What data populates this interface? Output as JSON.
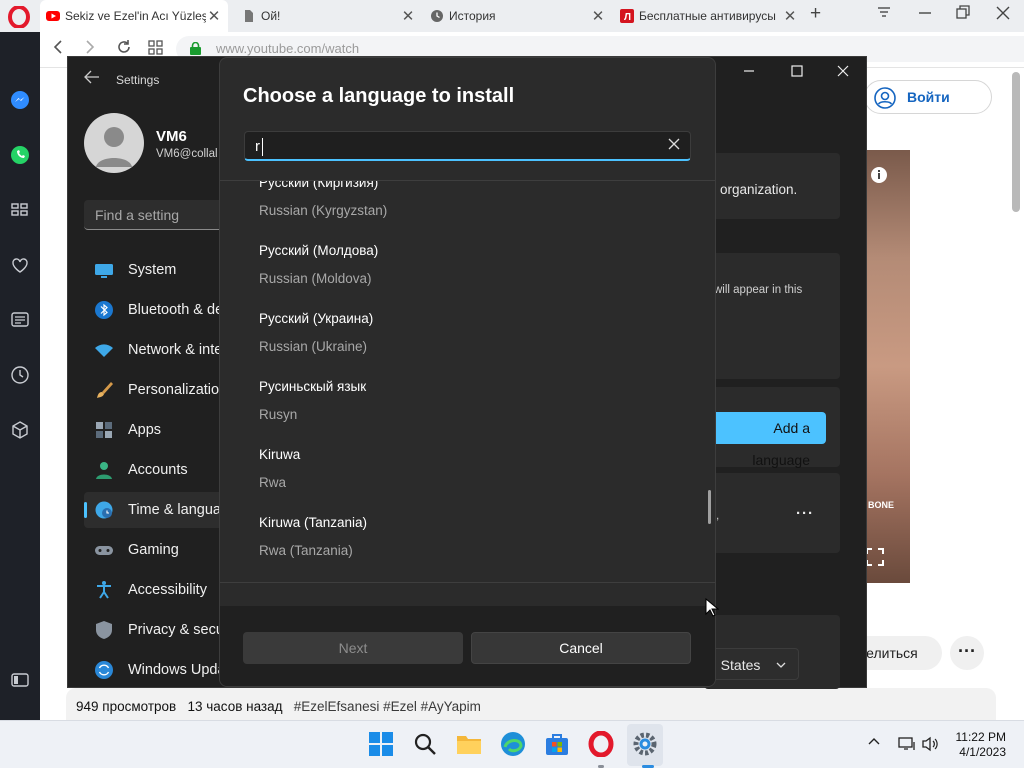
{
  "browser": {
    "tabs": [
      {
        "title": "Sekiz ve Ezel'in Acı Yüzleş",
        "close": "✕"
      },
      {
        "title": "Ой!",
        "close": "✕"
      },
      {
        "title": "История",
        "close": "✕"
      },
      {
        "title": "Бесплатные антивирусы",
        "close": "✕"
      }
    ],
    "new_tab": "+",
    "url": "www.youtube.com/watch"
  },
  "youtube": {
    "login_label": "Войти",
    "share_label": "делиться",
    "more_label": "···",
    "views": "949 просмотров",
    "age": "13 часов назад",
    "hashtags": "#EzelEfsanesi #Ezel #AyYapim",
    "video_overlay_text": "BONE"
  },
  "settings": {
    "title": "Settings",
    "user_name": "VM6",
    "user_email": "VM6@collal",
    "search_placeholder": "Find a setting",
    "nav": [
      {
        "label": "System",
        "icon": "monitor-icon"
      },
      {
        "label": "Bluetooth & de",
        "icon": "bluetooth-icon"
      },
      {
        "label": "Network & inte",
        "icon": "wifi-icon"
      },
      {
        "label": "Personalization",
        "icon": "brush-icon"
      },
      {
        "label": "Apps",
        "icon": "apps-icon"
      },
      {
        "label": "Accounts",
        "icon": "person-icon"
      },
      {
        "label": "Time & langua",
        "icon": "globe-clock-icon"
      },
      {
        "label": "Gaming",
        "icon": "gamepad-icon"
      },
      {
        "label": "Accessibility",
        "icon": "accessibility-icon"
      },
      {
        "label": "Privacy & secu",
        "icon": "shield-icon"
      },
      {
        "label": "Windows Upda",
        "icon": "update-icon"
      }
    ],
    "selected_nav": "Time & langua",
    "panel_text_1": "organization.",
    "panel_text_2": "will appear in this",
    "panel_text_3": "n,",
    "add_language_label": "Add a language",
    "region_value": "d States"
  },
  "dialog": {
    "title": "Choose a language to install",
    "search_value": "r",
    "languages": [
      {
        "native": "Русский (Киргизия)",
        "english": "Russian (Kyrgyzstan)"
      },
      {
        "native": "Русский (Молдова)",
        "english": "Russian (Moldova)"
      },
      {
        "native": "Русский (Украина)",
        "english": "Russian (Ukraine)"
      },
      {
        "native": "Русиньскый язык",
        "english": "Rusyn"
      },
      {
        "native": "Kiruwa",
        "english": "Rwa"
      },
      {
        "native": "Kiruwa (Tanzania)",
        "english": "Rwa (Tanzania)"
      }
    ],
    "next_label": "Next",
    "cancel_label": "Cancel"
  },
  "taskbar": {
    "apps": [
      "start-icon",
      "search-icon",
      "file-explorer-icon",
      "edge-icon",
      "store-icon",
      "opera-icon",
      "settings-icon"
    ],
    "time": "11:22 PM",
    "date": "4/1/2023"
  },
  "colors": {
    "accent": "#4cc2ff",
    "settings_bg": "#202020",
    "dialog_bg": "#2b2b2b",
    "youtube_red": "#ff0000",
    "opera_red": "#e3192c"
  }
}
